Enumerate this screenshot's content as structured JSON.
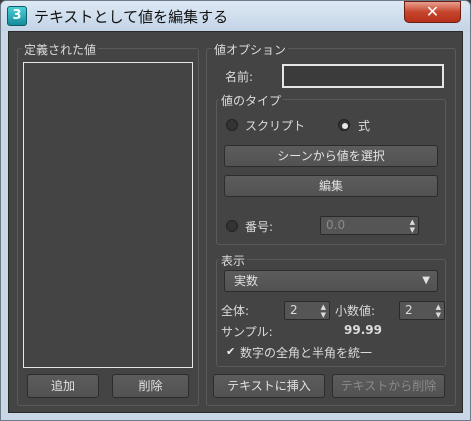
{
  "window": {
    "title": "テキストとして値を編集する",
    "app_icon": "3",
    "close_glyph": "✕"
  },
  "defined_values": {
    "label": "定義された値",
    "add_label": "追加",
    "delete_label": "削除"
  },
  "value_options": {
    "label": "値オプション",
    "name_label": "名前:",
    "name_value": "",
    "type": {
      "label": "値のタイプ",
      "script_label": "スクリプト",
      "formula_label": "式",
      "selected": "式",
      "select_from_scene_label": "シーンから値を選択",
      "edit_label": "編集",
      "number_label": "番号:",
      "number_value": "0.0"
    },
    "display": {
      "label": "表示",
      "format_value": "実数",
      "total_label": "全体:",
      "total_value": "2",
      "decimals_label": "小数値:",
      "decimals_value": "2",
      "sample_label": "サンプル:",
      "sample_value": "99.99",
      "unify_label": "数字の全角と半角を統一",
      "unify_checked": true
    }
  },
  "footer": {
    "insert_label": "テキストに挿入",
    "remove_label": "テキストから削除"
  },
  "icons": {
    "dropdown": "▼",
    "spinner": "▲▼",
    "check": "✔"
  }
}
